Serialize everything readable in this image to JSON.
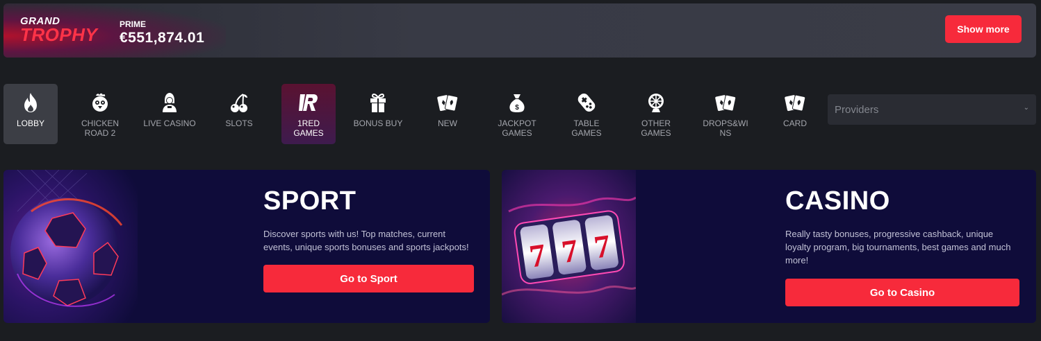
{
  "jackpot": {
    "logo_line1": "GRAND",
    "logo_line2": "TROPHY",
    "prime_label": "PRIME",
    "prime_amount": "€551,874.01",
    "show_more_label": "Show more"
  },
  "categories": [
    {
      "label": "LOBBY",
      "icon": "flame-icon"
    },
    {
      "label": "CHICKEN ROAD 2",
      "icon": "chicken-icon"
    },
    {
      "label": "LIVE CASINO",
      "icon": "dealer-icon"
    },
    {
      "label": "SLOTS",
      "icon": "cherries-icon"
    },
    {
      "label": "1RED GAMES",
      "icon": "1red-logo-icon"
    },
    {
      "label": "BONUS BUY",
      "icon": "gift-icon"
    },
    {
      "label": "NEW",
      "icon": "cards-icon"
    },
    {
      "label": "JACKPOT GAMES",
      "icon": "money-bag-icon"
    },
    {
      "label": "TABLE GAMES",
      "icon": "gamepad-icon"
    },
    {
      "label": "OTHER GAMES",
      "icon": "wheel-icon"
    },
    {
      "label": "DROPS&WINS",
      "icon": "cards-icon"
    },
    {
      "label": "CARD",
      "icon": "cards-icon"
    }
  ],
  "providers": {
    "placeholder": "Providers"
  },
  "sport": {
    "title": "SPORT",
    "description": "Discover sports with us! Top matches, current events, unique sports bonuses and sports jackpots!",
    "button": "Go to Sport"
  },
  "casino": {
    "title": "CASINO",
    "description": "Really tasty bonuses, progressive cashback, unique loyalty program, big tournaments, best games and much more!",
    "button": "Go to Casino"
  },
  "colors": {
    "accent": "#f72a3b",
    "background": "#1b1d21",
    "card": "#0f0c3a"
  }
}
